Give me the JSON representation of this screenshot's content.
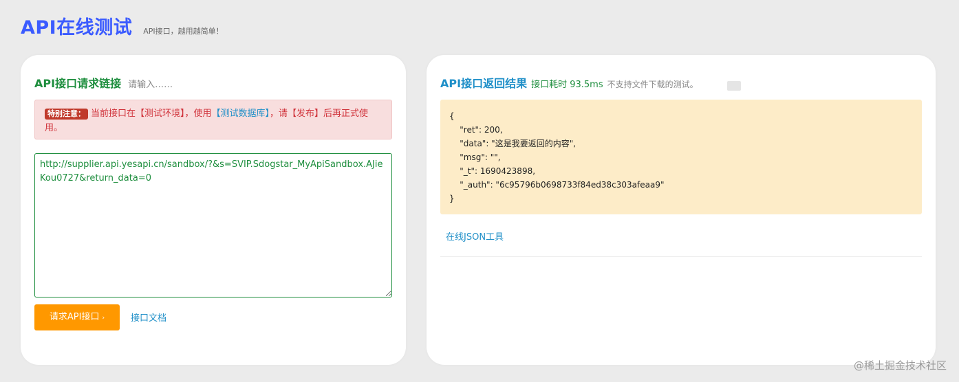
{
  "header": {
    "title": "API在线测试",
    "subtitle": "API接口，越用越简单！"
  },
  "request_panel": {
    "heading": "API接口请求链接",
    "hint": "请输入……",
    "alert": {
      "badge": "特别注意：",
      "text_part1": "当前接口在【测试环境】，使用",
      "highlight": "【测试数据库】",
      "text_part2": "，请【发布】后再正式使用。"
    },
    "url_value": "http://supplier.api.yesapi.cn/sandbox/?&s=SVIP.Sdogstar_MyApiSandbox.AJieKou0727&return_data=0",
    "request_button": "请求API接口",
    "request_button_caret": "›",
    "docs_link": "接口文档"
  },
  "result_panel": {
    "heading": "API接口返回结果",
    "elapsed": "接口耗时 93.5ms",
    "note": "不支持文件下载的测试。",
    "result_text": "{\n    \"ret\": 200,\n    \"data\": \"这是我要返回的内容\",\n    \"msg\": \"\",\n    \"_t\": 1690423898,\n    \"_auth\": \"6c95796b0698733f84ed38c303afeaa9\"\n}",
    "json_tool_link": "在线JSON工具"
  },
  "watermark": "@稀土掘金技术社区",
  "colors": {
    "title_blue": "#3b5bff",
    "green": "#1e8e3e",
    "link_blue": "#1f8fc8",
    "orange_button": "#ff9800",
    "alert_red": "#d0323a",
    "result_bg": "#fdecc8"
  }
}
